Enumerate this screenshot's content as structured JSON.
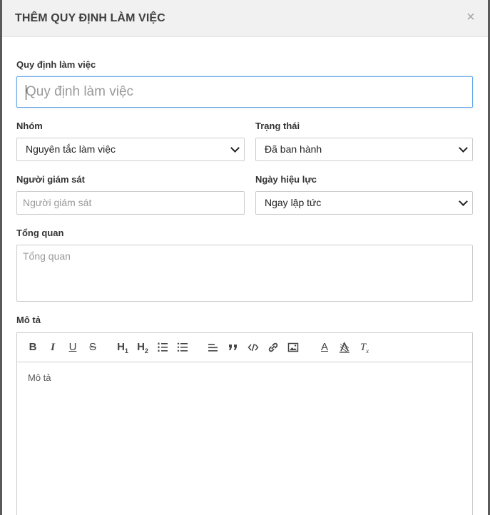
{
  "modal": {
    "title": "THÊM QUY ĐỊNH LÀM VIỆC",
    "close_label": "×"
  },
  "fields": {
    "rule": {
      "label": "Quy định làm việc",
      "placeholder": "Quy định làm việc"
    },
    "group": {
      "label": "Nhóm",
      "value": "Nguyên tắc làm việc"
    },
    "status": {
      "label": "Trạng thái",
      "value": "Đã ban hành"
    },
    "supervisor": {
      "label": "Người giám sát",
      "placeholder": "Người giám sát"
    },
    "effective_date": {
      "label": "Ngày hiệu lực",
      "value": "Ngay lập tức"
    },
    "overview": {
      "label": "Tổng quan",
      "placeholder": "Tổng quan"
    },
    "description": {
      "label": "Mô tả",
      "placeholder": "Mô tả"
    }
  },
  "toolbar": {
    "bold": "B",
    "italic": "I",
    "underline": "U",
    "strike": "S",
    "h1": "H",
    "h1_sub": "1",
    "h2": "H",
    "h2_sub": "2",
    "text_color": "A",
    "clear": "T",
    "clear_sub": "x"
  }
}
